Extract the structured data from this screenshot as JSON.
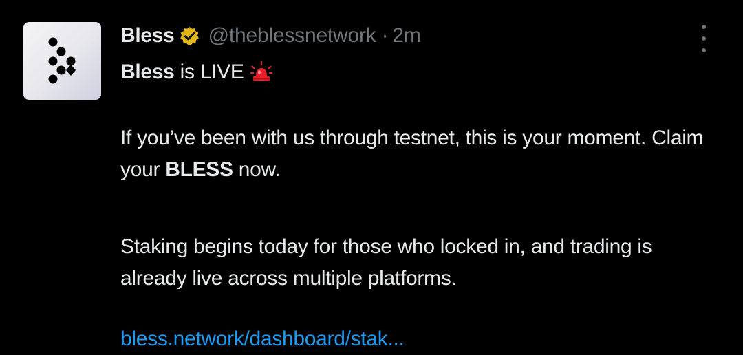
{
  "tweet": {
    "display_name": "Bless",
    "handle": "@theblessnetwork",
    "separator": "·",
    "time": "2m",
    "line1_bold": "Bless",
    "line1_rest": " is LIVE",
    "para2_pre": "If you’ve been with us through testnet, this is your moment. Claim your ",
    "para2_bold": "BLESS",
    "para2_post": " now.",
    "para3": "Staking begins today for those who locked in, and trading is already live across multiple platforms.",
    "link": "bless.network/dashboard/stak..."
  },
  "icons": {
    "avatar": "bless-logo-icon",
    "badge": "verified-badge-icon",
    "siren": "rotating-light-icon",
    "more": "more-options-icon"
  },
  "colors": {
    "background": "#000000",
    "text": "#e7e9ea",
    "muted": "#71767b",
    "link": "#1d9bf0",
    "badge": "#e2b719",
    "siren": "#e8202b"
  }
}
